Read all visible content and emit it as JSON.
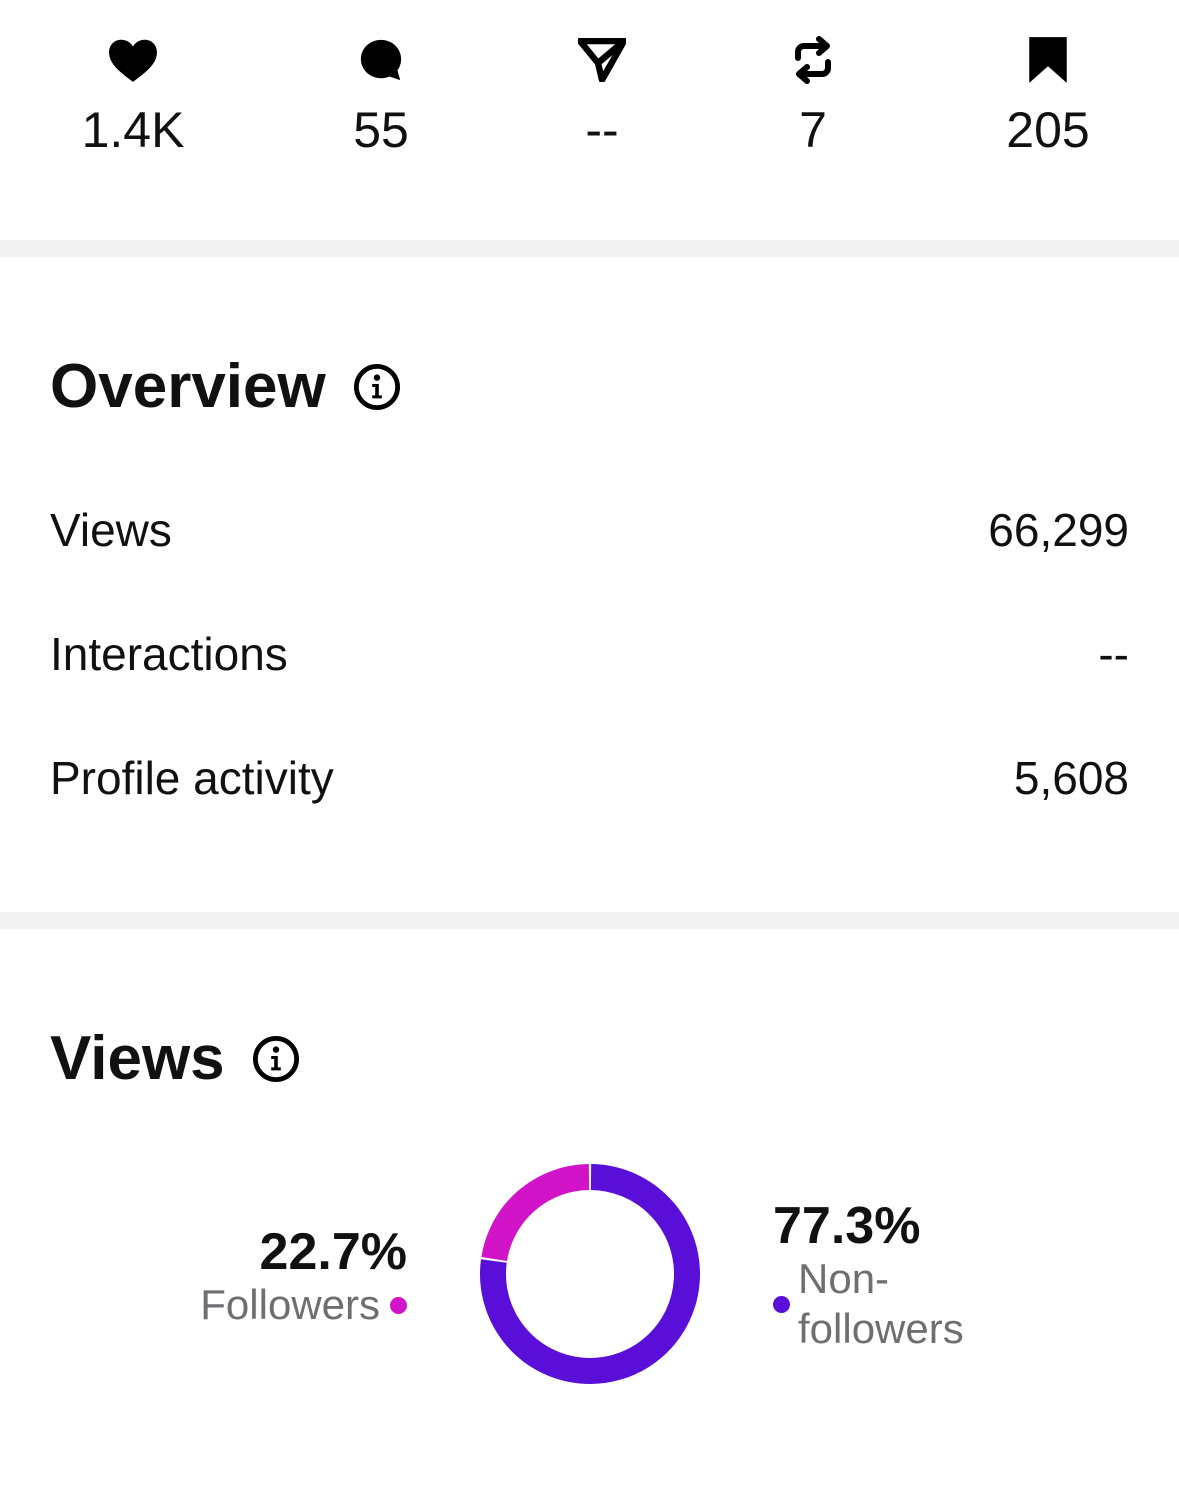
{
  "engagement": {
    "likes": {
      "icon": "heart-icon",
      "value": "1.4K"
    },
    "comments": {
      "icon": "comment-icon",
      "value": "55"
    },
    "shares": {
      "icon": "send-icon",
      "value": "--"
    },
    "reposts": {
      "icon": "repost-icon",
      "value": "7"
    },
    "saves": {
      "icon": "bookmark-icon",
      "value": "205"
    }
  },
  "overview": {
    "title": "Overview",
    "info_icon": "info-icon",
    "rows": [
      {
        "label": "Views",
        "value": "66,299"
      },
      {
        "label": "Interactions",
        "value": "--"
      },
      {
        "label": "Profile activity",
        "value": "5,608"
      }
    ]
  },
  "views_section": {
    "title": "Views",
    "info_icon": "info-icon"
  },
  "chart_data": {
    "type": "pie",
    "variant": "donut",
    "categories": [
      "Followers",
      "Non-followers"
    ],
    "values": [
      22.7,
      77.3
    ],
    "value_labels": [
      "22.7%",
      "77.3%"
    ],
    "colors": [
      "#d214c8",
      "#5a0fd9"
    ]
  },
  "colors": {
    "text": "#111111",
    "secondary_text": "#6e6e73",
    "divider": "#f3f3f3",
    "followers": "#d214c8",
    "non_followers": "#5a0fd9"
  }
}
